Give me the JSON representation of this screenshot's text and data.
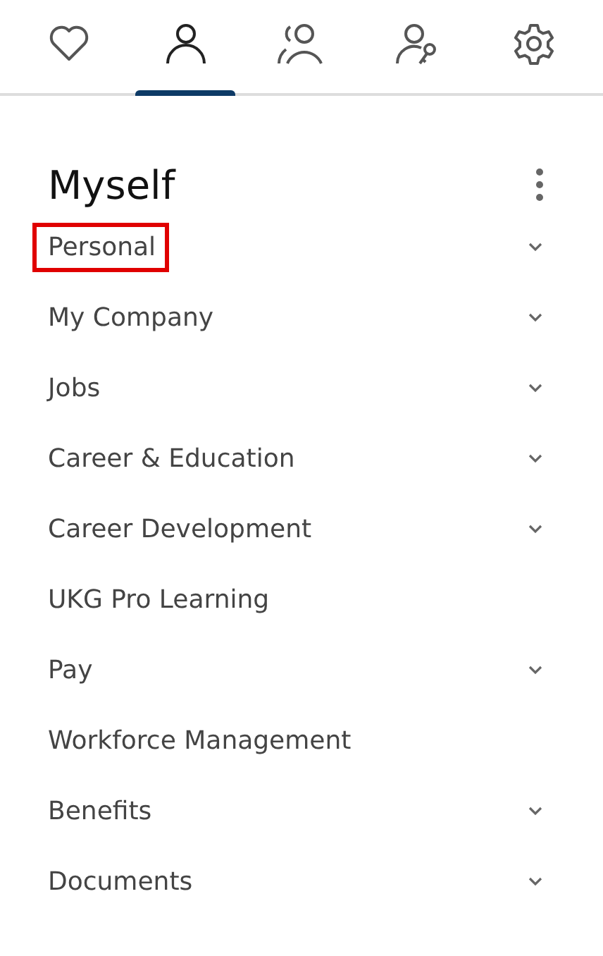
{
  "tabs": [
    {
      "kind": "heart",
      "selected": false
    },
    {
      "kind": "person",
      "selected": true
    },
    {
      "kind": "people",
      "selected": false
    },
    {
      "kind": "person-key",
      "selected": false
    },
    {
      "kind": "gear",
      "selected": false
    }
  ],
  "title": "Myself",
  "items": [
    {
      "label": "Personal",
      "expandable": true,
      "highlighted": true
    },
    {
      "label": "My Company",
      "expandable": true,
      "highlighted": false
    },
    {
      "label": "Jobs",
      "expandable": true,
      "highlighted": false
    },
    {
      "label": "Career & Education",
      "expandable": true,
      "highlighted": false
    },
    {
      "label": "Career Development",
      "expandable": true,
      "highlighted": false
    },
    {
      "label": "UKG Pro Learning",
      "expandable": false,
      "highlighted": false
    },
    {
      "label": "Pay",
      "expandable": true,
      "highlighted": false
    },
    {
      "label": "Workforce Management",
      "expandable": false,
      "highlighted": false
    },
    {
      "label": "Benefits",
      "expandable": true,
      "highlighted": false
    },
    {
      "label": "Documents",
      "expandable": true,
      "highlighted": false
    }
  ]
}
